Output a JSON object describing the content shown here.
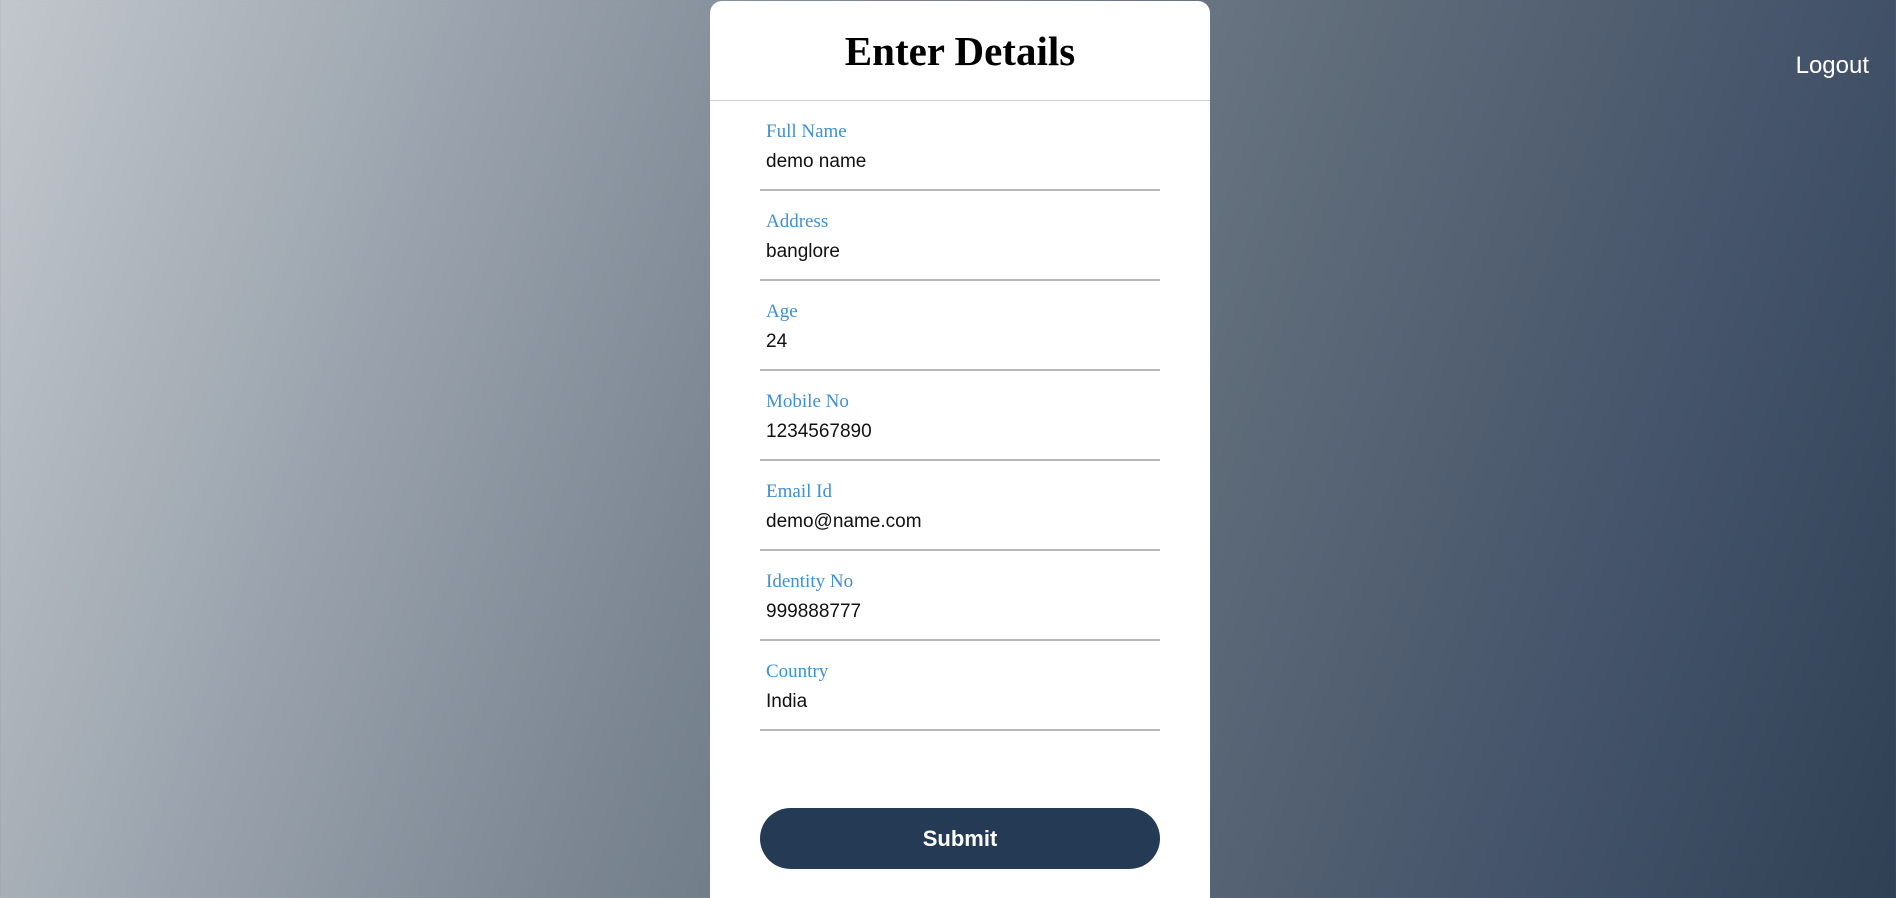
{
  "header": {
    "logout_label": "Logout"
  },
  "form": {
    "title": "Enter Details",
    "fields": [
      {
        "label": "Full Name",
        "value": "demo name"
      },
      {
        "label": "Address",
        "value": "banglore"
      },
      {
        "label": "Age",
        "value": "24"
      },
      {
        "label": "Mobile No",
        "value": "1234567890"
      },
      {
        "label": "Email Id",
        "value": "demo@name.com"
      },
      {
        "label": "Identity No",
        "value": "999888777"
      },
      {
        "label": "Country",
        "value": "India"
      }
    ],
    "submit_label": "Submit"
  },
  "colors": {
    "label": "#3e8fd4",
    "button": "#243a55",
    "background_light": "#c2c7cc",
    "background_dark": "#2f4054"
  }
}
